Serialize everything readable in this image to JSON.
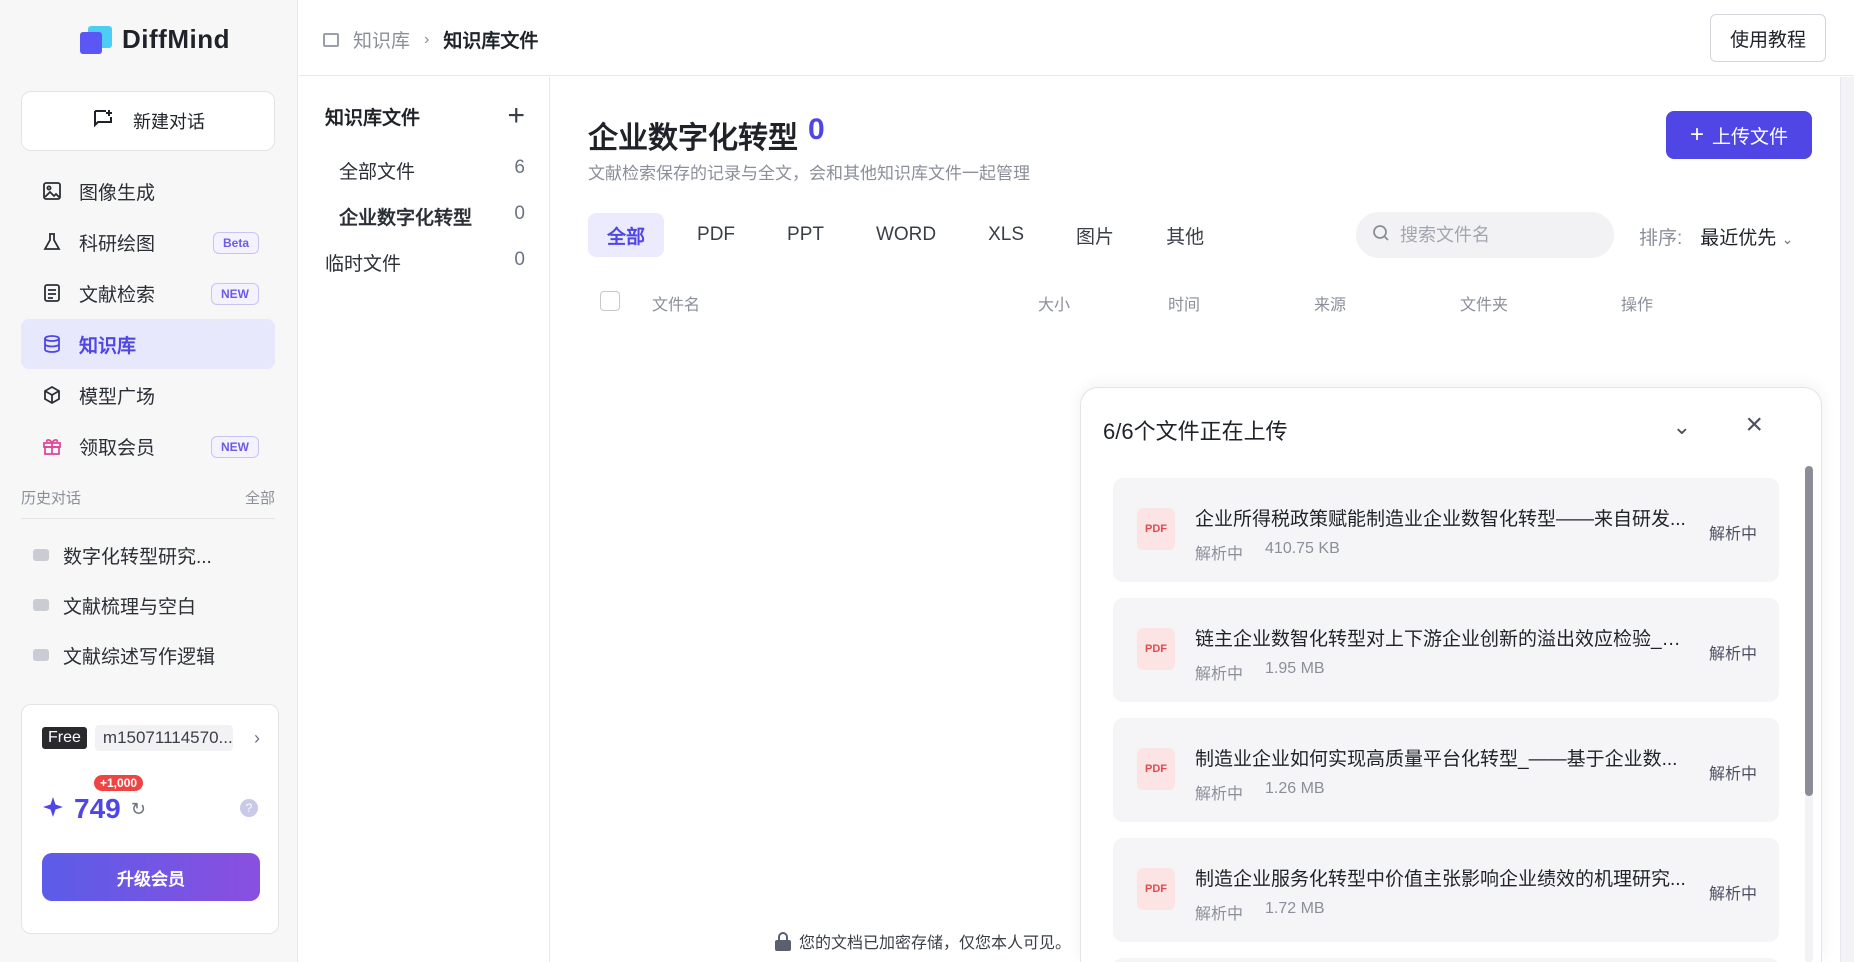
{
  "app": {
    "logo_text": "DiffMind"
  },
  "sidebar": {
    "new_chat_label": "新建对话",
    "items": [
      {
        "label": "图像生成",
        "icon": "image-icon"
      },
      {
        "label": "科研绘图",
        "icon": "flask-icon",
        "badge": "Beta"
      },
      {
        "label": "文献检索",
        "icon": "document-icon",
        "badge": "NEW"
      },
      {
        "label": "知识库",
        "icon": "database-icon",
        "active": true
      },
      {
        "label": "模型广场",
        "icon": "cube-icon"
      },
      {
        "label": "领取会员",
        "icon": "gift-icon",
        "badge": "NEW"
      }
    ],
    "history_title": "历史对话",
    "history_all": "全部",
    "history": [
      "数字化转型研究...",
      "文献梳理与空白",
      "文献综述写作逻辑"
    ]
  },
  "account": {
    "plan": "Free",
    "username": "m15071114570...",
    "credits": "749",
    "credit_bonus": "+1,000",
    "help": "?",
    "upgrade_label": "升级会员"
  },
  "topbar": {
    "breadcrumb_parent": "知识库",
    "breadcrumb_current": "知识库文件",
    "tutorial_label": "使用教程"
  },
  "folders": {
    "title": "知识库文件",
    "items": [
      {
        "label": "全部文件",
        "count": "6"
      },
      {
        "label": "企业数字化转型",
        "count": "0"
      },
      {
        "label": "临时文件",
        "count": "0"
      }
    ]
  },
  "main": {
    "title": "企业数字化转型",
    "count": "0",
    "subtitle": "文献检索保存的记录与全文，会和其他知识库文件一起管理",
    "upload_label": "上传文件",
    "tabs": [
      "全部",
      "PDF",
      "PPT",
      "WORD",
      "XLS",
      "图片",
      "其他"
    ],
    "search_placeholder": "搜索文件名",
    "sort_label": "排序:",
    "sort_value": "最近优先",
    "columns": [
      "文件名",
      "大小",
      "时间",
      "来源",
      "文件夹",
      "操作"
    ],
    "footer_note": "您的文档已加密存储，仅您本人可见。"
  },
  "upload_panel": {
    "title": "6/6个文件正在上传",
    "files": [
      {
        "name": "企业所得税政策赋能制造业企业数智化转型——来自研发...",
        "status": "解析中",
        "size": "410.75 KB",
        "state": "解析中",
        "type": "PDF"
      },
      {
        "name": "链主企业数智化转型对上下游企业创新的溢出效应检验_赵...",
        "status": "解析中",
        "size": "1.95 MB",
        "state": "解析中",
        "type": "PDF"
      },
      {
        "name": "制造业企业如何实现高质量平台化转型_——基于企业数...",
        "status": "解析中",
        "size": "1.26 MB",
        "state": "解析中",
        "type": "PDF"
      },
      {
        "name": "制造企业服务化转型中价值主张影响企业绩效的机理研究...",
        "status": "解析中",
        "size": "1.72 MB",
        "state": "解析中",
        "type": "PDF"
      }
    ]
  },
  "colors": {
    "accent": "#4f46e5",
    "active_bg": "#e8e8fd",
    "pdf_red": "#e24b4b"
  }
}
